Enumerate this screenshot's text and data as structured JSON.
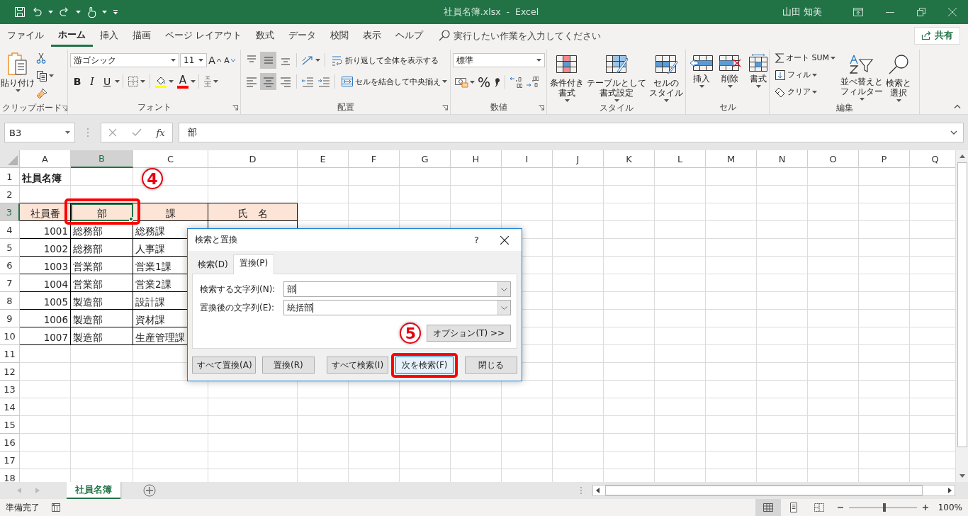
{
  "title_bar": {
    "title": "社員名簿.xlsx  -  Excel",
    "user": "山田 知美"
  },
  "menu_tabs": [
    {
      "label": "ファイル",
      "selected": false
    },
    {
      "label": "ホーム",
      "selected": true
    },
    {
      "label": "挿入",
      "selected": false
    },
    {
      "label": "描画",
      "selected": false
    },
    {
      "label": "ページ レイアウト",
      "selected": false
    },
    {
      "label": "数式",
      "selected": false
    },
    {
      "label": "データ",
      "selected": false
    },
    {
      "label": "校閲",
      "selected": false
    },
    {
      "label": "表示",
      "selected": false
    },
    {
      "label": "ヘルプ",
      "selected": false
    }
  ],
  "tell_me": {
    "placeholder": "実行したい作業を入力してください"
  },
  "share_button": {
    "label": "共有"
  },
  "ribbon": {
    "clipboard": {
      "label": "クリップボード",
      "paste": "貼り付け"
    },
    "font": {
      "label": "フォント",
      "font_name": "游ゴシック",
      "font_size": "11",
      "grow": "A",
      "shrink": "A",
      "bold": "B",
      "italic": "I",
      "underline": "U",
      "font_color": "A"
    },
    "alignment": {
      "label": "配置",
      "vertical": [
        {
          "selected": false
        },
        {
          "selected": true
        },
        {
          "selected": false
        }
      ],
      "horizontal": [
        {
          "selected": false
        },
        {
          "selected": true
        },
        {
          "selected": false
        }
      ],
      "wrap_text": "折り返して全体を表示する",
      "merge_center": "セルを結合して中央揃え"
    },
    "number": {
      "label": "数値",
      "format": "標準",
      "percent": "%"
    },
    "styles": {
      "label": "スタイル",
      "buttons": [
        {
          "lines": [
            "条件付き",
            "書式"
          ]
        },
        {
          "lines": [
            "テーブルとして",
            "書式設定"
          ]
        },
        {
          "lines": [
            "セルの",
            "スタイル"
          ]
        }
      ]
    },
    "cells": {
      "label": "セル",
      "buttons": [
        {
          "label": "挿入"
        },
        {
          "label": "削除"
        },
        {
          "label": "書式"
        }
      ]
    },
    "editing": {
      "label": "編集",
      "autosum": "オート SUM",
      "fill": "フィル",
      "clear": "クリア",
      "sort": {
        "lines": [
          "並べ替えと",
          "フィルター"
        ]
      },
      "find": {
        "lines": [
          "検索と",
          "選択"
        ]
      }
    }
  },
  "formula_bar": {
    "name_box": "B3",
    "function_label": "fx",
    "formula": "部"
  },
  "grid": {
    "columns": [
      {
        "label": "A",
        "selected": false
      },
      {
        "label": "B",
        "selected": true
      },
      {
        "label": "C",
        "selected": false
      },
      {
        "label": "D",
        "selected": false
      },
      {
        "label": "E",
        "selected": false
      },
      {
        "label": "F",
        "selected": false
      },
      {
        "label": "G",
        "selected": false
      },
      {
        "label": "H",
        "selected": false
      },
      {
        "label": "I",
        "selected": false
      },
      {
        "label": "J",
        "selected": false
      },
      {
        "label": "K",
        "selected": false
      },
      {
        "label": "L",
        "selected": false
      },
      {
        "label": "M",
        "selected": false
      },
      {
        "label": "N",
        "selected": false
      },
      {
        "label": "O",
        "selected": false
      },
      {
        "label": "P",
        "selected": false
      },
      {
        "label": "Q",
        "selected": false
      }
    ],
    "rows": [
      {
        "number": "1",
        "selected": false,
        "bordered": false,
        "cells": [
          {
            "text": "社員名簿",
            "kind": "title",
            "highlighted": false
          }
        ]
      },
      {
        "number": "2",
        "selected": false,
        "bordered": false
      },
      {
        "number": "3",
        "selected": true,
        "bordered": true,
        "cells": [
          {
            "text": "社員番",
            "kind": "header",
            "highlighted": false
          },
          {
            "text": "部",
            "kind": "header",
            "highlighted": true
          },
          {
            "text": "課",
            "kind": "header",
            "highlighted": false
          },
          {
            "text": "氏　名",
            "kind": "header",
            "highlighted": false
          }
        ]
      },
      {
        "number": "4",
        "selected": false,
        "bordered": true,
        "cells": [
          {
            "text": "1001",
            "kind": "number",
            "highlighted": false
          },
          {
            "text": "総務部",
            "kind": "text",
            "highlighted": false
          },
          {
            "text": "総務課",
            "kind": "text",
            "highlighted": false
          }
        ]
      },
      {
        "number": "5",
        "selected": false,
        "bordered": true,
        "cells": [
          {
            "text": "1002",
            "kind": "number",
            "highlighted": false
          },
          {
            "text": "総務部",
            "kind": "text",
            "highlighted": false
          },
          {
            "text": "人事課",
            "kind": "text",
            "highlighted": false
          }
        ]
      },
      {
        "number": "6",
        "selected": false,
        "bordered": true,
        "cells": [
          {
            "text": "1003",
            "kind": "number",
            "highlighted": false
          },
          {
            "text": "営業部",
            "kind": "text",
            "highlighted": false
          },
          {
            "text": "営業1課",
            "kind": "text",
            "highlighted": false
          }
        ]
      },
      {
        "number": "7",
        "selected": false,
        "bordered": true,
        "cells": [
          {
            "text": "1004",
            "kind": "number",
            "highlighted": false
          },
          {
            "text": "営業部",
            "kind": "text",
            "highlighted": false
          },
          {
            "text": "営業2課",
            "kind": "text",
            "highlighted": false
          }
        ]
      },
      {
        "number": "8",
        "selected": false,
        "bordered": true,
        "cells": [
          {
            "text": "1005",
            "kind": "number",
            "highlighted": false
          },
          {
            "text": "製造部",
            "kind": "text",
            "highlighted": false
          },
          {
            "text": "設計課",
            "kind": "text",
            "highlighted": false
          }
        ]
      },
      {
        "number": "9",
        "selected": false,
        "bordered": true,
        "cells": [
          {
            "text": "1006",
            "kind": "number",
            "highlighted": false
          },
          {
            "text": "製造部",
            "kind": "text",
            "highlighted": false
          },
          {
            "text": "資材課",
            "kind": "text",
            "highlighted": false
          }
        ]
      },
      {
        "number": "10",
        "selected": false,
        "bordered": true,
        "cells": [
          {
            "text": "1007",
            "kind": "number",
            "highlighted": false
          },
          {
            "text": "製造部",
            "kind": "text",
            "highlighted": false
          },
          {
            "text": "生産管理課",
            "kind": "text",
            "highlighted": false
          }
        ]
      },
      {
        "number": "11",
        "selected": false,
        "bordered": false
      },
      {
        "number": "12",
        "selected": false,
        "bordered": false
      },
      {
        "number": "13",
        "selected": false,
        "bordered": false
      },
      {
        "number": "14",
        "selected": false,
        "bordered": false
      },
      {
        "number": "15",
        "selected": false,
        "bordered": false
      },
      {
        "number": "16",
        "selected": false,
        "bordered": false
      },
      {
        "number": "17",
        "selected": false,
        "bordered": false
      },
      {
        "number": "18",
        "selected": false,
        "bordered": false
      }
    ],
    "callout": {
      "label": "4"
    }
  },
  "dialog": {
    "title": "検索と置換",
    "help": "?",
    "tabs": [
      {
        "label": "検索(D)",
        "selected": false
      },
      {
        "label": "置換(P)",
        "selected": true
      }
    ],
    "fields": [
      {
        "label": "検索する文字列(N):",
        "value": "部"
      },
      {
        "label": "置換後の文字列(E):",
        "value": "統括部"
      }
    ],
    "callout": {
      "label": "5"
    },
    "options_button": "オプション(T) >>",
    "buttons": [
      {
        "label": "すべて置換(A)",
        "focused": false,
        "highlighted": false
      },
      {
        "label": "置換(R)",
        "focused": false,
        "highlighted": false
      },
      {
        "label": "すべて検索(I)",
        "focused": false,
        "highlighted": false
      },
      {
        "label": "次を検索(F)",
        "focused": true,
        "highlighted": true
      },
      {
        "label": "閉じる",
        "focused": false,
        "highlighted": false
      }
    ]
  },
  "sheet_tabs": [
    {
      "label": "社員名簿",
      "selected": true
    }
  ],
  "status_bar": {
    "status": "準備完了",
    "views": [
      {
        "selected": true
      },
      {
        "selected": false
      },
      {
        "selected": false
      }
    ],
    "zoom_slider": {
      "level": 0.52
    },
    "zoom": "100%"
  }
}
